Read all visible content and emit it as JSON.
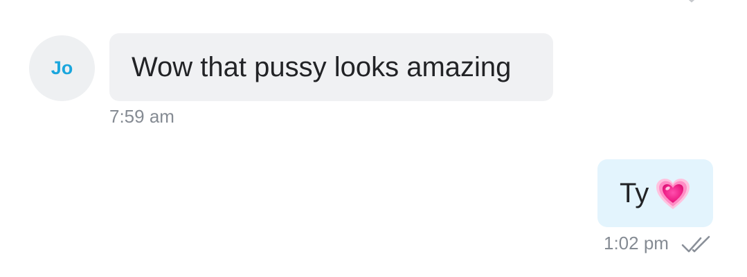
{
  "incoming": {
    "avatar_initials": "Jo",
    "message": "Wow that pussy looks amazing",
    "time": "7:59 am"
  },
  "outgoing": {
    "message": "Ty",
    "emoji_icon": "growing-heart-icon",
    "time": "1:02 pm",
    "status_icon": "double-check-read-icon"
  },
  "colors": {
    "incoming_bubble": "#f0f1f3",
    "outgoing_bubble": "#e3f4fd",
    "avatar_text": "#1aa6dd",
    "avatar_bg": "#eef0f2",
    "timestamp": "#858b93",
    "message_text": "#222326"
  }
}
